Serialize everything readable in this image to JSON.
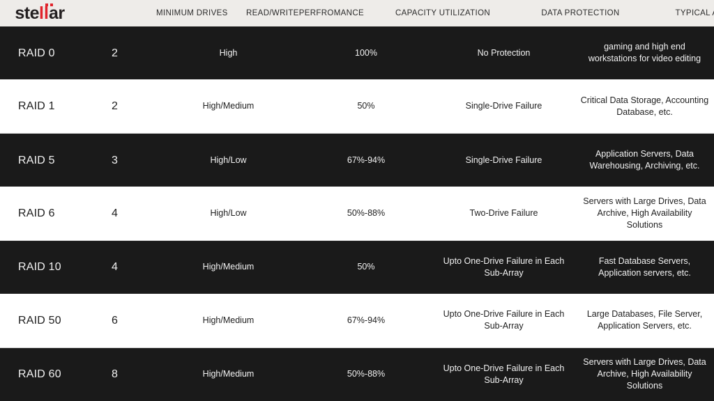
{
  "brand": {
    "logo_text_part1": "ste",
    "logo_text_red": "ll",
    "logo_text_part2": "ar",
    "logo_full": "stellar",
    "red_hex": "#e0232b",
    "dark_hex": "#231f20"
  },
  "theme": {
    "header_bg": "#eeece9",
    "dark_row_bg": "#1a1a1a",
    "light_row_bg": "#ffffff",
    "dark_row_text": "#f2f2f2",
    "light_row_text": "#1e1e1e"
  },
  "table": {
    "columns": [
      {
        "key": "level",
        "label": ""
      },
      {
        "key": "drives",
        "label": "MINIMUM DRIVES"
      },
      {
        "key": "perf",
        "label": "READ/WRITEPERFROMANCE"
      },
      {
        "key": "capacity",
        "label": "CAPACITY UTILIZATION"
      },
      {
        "key": "protect",
        "label": "DATA PROTECTION"
      },
      {
        "key": "app",
        "label": "TYPICAL APPLICATION"
      }
    ],
    "rows": [
      {
        "level": "RAID 0",
        "drives": "2",
        "perf": "High",
        "capacity": "100%",
        "protect": "No Protection",
        "app": "gaming and high end workstations for video editing",
        "style": "dark"
      },
      {
        "level": "RAID 1",
        "drives": "2",
        "perf": "High/Medium",
        "capacity": "50%",
        "protect": "Single-Drive Failure",
        "app": "Critical Data Storage, Accounting Database, etc.",
        "style": "light"
      },
      {
        "level": "RAID 5",
        "drives": "3",
        "perf": "High/Low",
        "capacity": "67%-94%",
        "protect": "Single-Drive Failure",
        "app": "Application Servers, Data Warehousing, Archiving, etc.",
        "style": "dark"
      },
      {
        "level": "RAID 6",
        "drives": "4",
        "perf": "High/Low",
        "capacity": "50%-88%",
        "protect": "Two-Drive Failure",
        "app": "Servers with Large Drives, Data Archive, High Availability Solutions",
        "style": "light"
      },
      {
        "level": "RAID 10",
        "drives": "4",
        "perf": "High/Medium",
        "capacity": "50%",
        "protect": "Upto One-Drive Failure in Each Sub-Array",
        "app": "Fast Database Servers, Application servers, etc.",
        "style": "dark"
      },
      {
        "level": "RAID 50",
        "drives": "6",
        "perf": "High/Medium",
        "capacity": "67%-94%",
        "protect": "Upto One-Drive Failure in Each Sub-Array",
        "app": "Large Databases, File Server, Application Servers, etc.",
        "style": "light"
      },
      {
        "level": "RAID 60",
        "drives": "8",
        "perf": "High/Medium",
        "capacity": "50%-88%",
        "protect": "Upto One-Drive Failure in Each Sub-Array",
        "app": "Servers with Large Drives, Data Archive, High Availability Solutions",
        "style": "dark"
      }
    ]
  }
}
